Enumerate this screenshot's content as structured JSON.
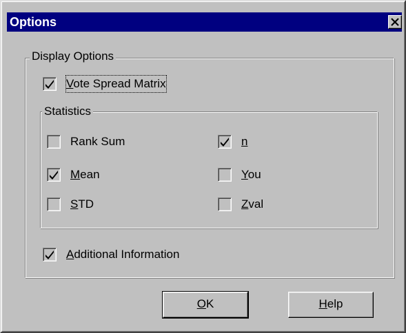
{
  "window": {
    "title": "Options"
  },
  "display_group": {
    "legend": "Display Options",
    "vote_spread": {
      "prefix": "",
      "key": "V",
      "rest": "ote Spread Matrix",
      "checked": true
    }
  },
  "statistics_group": {
    "legend": "Statistics",
    "rank_sum": {
      "prefix": "Rank Sum",
      "key": "",
      "rest": "",
      "checked": false
    },
    "mean": {
      "prefix": "",
      "key": "M",
      "rest": "ean",
      "checked": true
    },
    "std": {
      "prefix": "",
      "key": "S",
      "rest": "TD",
      "checked": false
    },
    "n": {
      "prefix": "",
      "key": "n",
      "rest": "",
      "checked": true
    },
    "you": {
      "prefix": "",
      "key": "Y",
      "rest": "ou",
      "checked": false
    },
    "zval": {
      "prefix": "",
      "key": "Z",
      "rest": "val",
      "checked": false
    }
  },
  "additional_info": {
    "prefix": "",
    "key": "A",
    "rest": "dditional Information",
    "checked": true
  },
  "buttons": {
    "ok": {
      "key": "O",
      "rest": "K"
    },
    "help": {
      "key": "H",
      "rest": "elp"
    }
  },
  "icons": {
    "close": "close-x-icon",
    "check": "checkmark-icon"
  }
}
